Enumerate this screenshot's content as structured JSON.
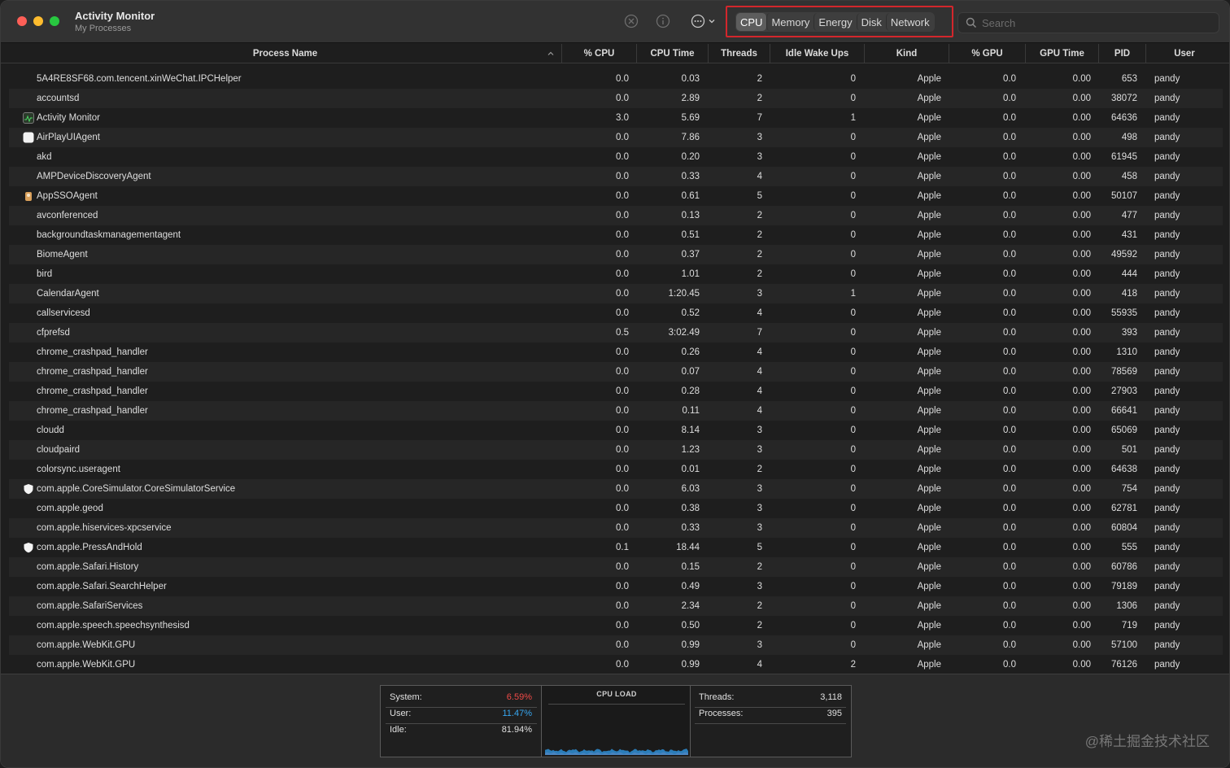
{
  "window": {
    "title": "Activity Monitor",
    "subtitle": "My Processes"
  },
  "toolbar": {
    "tabs": [
      {
        "label": "CPU",
        "active": true
      },
      {
        "label": "Memory",
        "active": false
      },
      {
        "label": "Energy",
        "active": false
      },
      {
        "label": "Disk",
        "active": false
      },
      {
        "label": "Network",
        "active": false
      }
    ],
    "search_placeholder": "Search",
    "icons": [
      "stop-process-icon",
      "info-icon",
      "more-actions-icon",
      "chevron-down-icon",
      "search-icon"
    ],
    "highlight_color": "#d3262c"
  },
  "table": {
    "columns": [
      "Process Name",
      "% CPU",
      "CPU Time",
      "Threads",
      "Idle Wake Ups",
      "Kind",
      "% GPU",
      "GPU Time",
      "PID",
      "User"
    ],
    "sorted_column": "Process Name",
    "sort_direction": "ascending",
    "rows": [
      {
        "name": "5A4RE8SF68.com.tencent.xinWeChat.IPCHelper",
        "cpu": "0.0",
        "cpu_time": "0.03",
        "threads": "2",
        "idle": "0",
        "kind": "Apple",
        "gpu": "0.0",
        "gpu_time": "0.00",
        "pid": "653",
        "user": "pandy",
        "icon": ""
      },
      {
        "name": "accountsd",
        "cpu": "0.0",
        "cpu_time": "2.89",
        "threads": "2",
        "idle": "0",
        "kind": "Apple",
        "gpu": "0.0",
        "gpu_time": "0.00",
        "pid": "38072",
        "user": "pandy",
        "icon": ""
      },
      {
        "name": "Activity Monitor",
        "cpu": "3.0",
        "cpu_time": "5.69",
        "threads": "7",
        "idle": "1",
        "kind": "Apple",
        "gpu": "0.0",
        "gpu_time": "0.00",
        "pid": "64636",
        "user": "pandy",
        "icon": "activity-monitor-icon"
      },
      {
        "name": "AirPlayUIAgent",
        "cpu": "0.0",
        "cpu_time": "7.86",
        "threads": "3",
        "idle": "0",
        "kind": "Apple",
        "gpu": "0.0",
        "gpu_time": "0.00",
        "pid": "498",
        "user": "pandy",
        "icon": "airplay-icon"
      },
      {
        "name": "akd",
        "cpu": "0.0",
        "cpu_time": "0.20",
        "threads": "3",
        "idle": "0",
        "kind": "Apple",
        "gpu": "0.0",
        "gpu_time": "0.00",
        "pid": "61945",
        "user": "pandy",
        "icon": ""
      },
      {
        "name": "AMPDeviceDiscoveryAgent",
        "cpu": "0.0",
        "cpu_time": "0.33",
        "threads": "4",
        "idle": "0",
        "kind": "Apple",
        "gpu": "0.0",
        "gpu_time": "0.00",
        "pid": "458",
        "user": "pandy",
        "icon": ""
      },
      {
        "name": "AppSSOAgent",
        "cpu": "0.0",
        "cpu_time": "0.61",
        "threads": "5",
        "idle": "0",
        "kind": "Apple",
        "gpu": "0.0",
        "gpu_time": "0.00",
        "pid": "50107",
        "user": "pandy",
        "icon": "app-sso-icon"
      },
      {
        "name": "avconferenced",
        "cpu": "0.0",
        "cpu_time": "0.13",
        "threads": "2",
        "idle": "0",
        "kind": "Apple",
        "gpu": "0.0",
        "gpu_time": "0.00",
        "pid": "477",
        "user": "pandy",
        "icon": ""
      },
      {
        "name": "backgroundtaskmanagementagent",
        "cpu": "0.0",
        "cpu_time": "0.51",
        "threads": "2",
        "idle": "0",
        "kind": "Apple",
        "gpu": "0.0",
        "gpu_time": "0.00",
        "pid": "431",
        "user": "pandy",
        "icon": ""
      },
      {
        "name": "BiomeAgent",
        "cpu": "0.0",
        "cpu_time": "0.37",
        "threads": "2",
        "idle": "0",
        "kind": "Apple",
        "gpu": "0.0",
        "gpu_time": "0.00",
        "pid": "49592",
        "user": "pandy",
        "icon": ""
      },
      {
        "name": "bird",
        "cpu": "0.0",
        "cpu_time": "1.01",
        "threads": "2",
        "idle": "0",
        "kind": "Apple",
        "gpu": "0.0",
        "gpu_time": "0.00",
        "pid": "444",
        "user": "pandy",
        "icon": ""
      },
      {
        "name": "CalendarAgent",
        "cpu": "0.0",
        "cpu_time": "1:20.45",
        "threads": "3",
        "idle": "1",
        "kind": "Apple",
        "gpu": "0.0",
        "gpu_time": "0.00",
        "pid": "418",
        "user": "pandy",
        "icon": ""
      },
      {
        "name": "callservicesd",
        "cpu": "0.0",
        "cpu_time": "0.52",
        "threads": "4",
        "idle": "0",
        "kind": "Apple",
        "gpu": "0.0",
        "gpu_time": "0.00",
        "pid": "55935",
        "user": "pandy",
        "icon": ""
      },
      {
        "name": "cfprefsd",
        "cpu": "0.5",
        "cpu_time": "3:02.49",
        "threads": "7",
        "idle": "0",
        "kind": "Apple",
        "gpu": "0.0",
        "gpu_time": "0.00",
        "pid": "393",
        "user": "pandy",
        "icon": ""
      },
      {
        "name": "chrome_crashpad_handler",
        "cpu": "0.0",
        "cpu_time": "0.26",
        "threads": "4",
        "idle": "0",
        "kind": "Apple",
        "gpu": "0.0",
        "gpu_time": "0.00",
        "pid": "1310",
        "user": "pandy",
        "icon": ""
      },
      {
        "name": "chrome_crashpad_handler",
        "cpu": "0.0",
        "cpu_time": "0.07",
        "threads": "4",
        "idle": "0",
        "kind": "Apple",
        "gpu": "0.0",
        "gpu_time": "0.00",
        "pid": "78569",
        "user": "pandy",
        "icon": ""
      },
      {
        "name": "chrome_crashpad_handler",
        "cpu": "0.0",
        "cpu_time": "0.28",
        "threads": "4",
        "idle": "0",
        "kind": "Apple",
        "gpu": "0.0",
        "gpu_time": "0.00",
        "pid": "27903",
        "user": "pandy",
        "icon": ""
      },
      {
        "name": "chrome_crashpad_handler",
        "cpu": "0.0",
        "cpu_time": "0.11",
        "threads": "4",
        "idle": "0",
        "kind": "Apple",
        "gpu": "0.0",
        "gpu_time": "0.00",
        "pid": "66641",
        "user": "pandy",
        "icon": ""
      },
      {
        "name": "cloudd",
        "cpu": "0.0",
        "cpu_time": "8.14",
        "threads": "3",
        "idle": "0",
        "kind": "Apple",
        "gpu": "0.0",
        "gpu_time": "0.00",
        "pid": "65069",
        "user": "pandy",
        "icon": ""
      },
      {
        "name": "cloudpaird",
        "cpu": "0.0",
        "cpu_time": "1.23",
        "threads": "3",
        "idle": "0",
        "kind": "Apple",
        "gpu": "0.0",
        "gpu_time": "0.00",
        "pid": "501",
        "user": "pandy",
        "icon": ""
      },
      {
        "name": "colorsync.useragent",
        "cpu": "0.0",
        "cpu_time": "0.01",
        "threads": "2",
        "idle": "0",
        "kind": "Apple",
        "gpu": "0.0",
        "gpu_time": "0.00",
        "pid": "64638",
        "user": "pandy",
        "icon": ""
      },
      {
        "name": "com.apple.CoreSimulator.CoreSimulatorService",
        "cpu": "0.0",
        "cpu_time": "6.03",
        "threads": "3",
        "idle": "0",
        "kind": "Apple",
        "gpu": "0.0",
        "gpu_time": "0.00",
        "pid": "754",
        "user": "pandy",
        "icon": "shield-icon"
      },
      {
        "name": "com.apple.geod",
        "cpu": "0.0",
        "cpu_time": "0.38",
        "threads": "3",
        "idle": "0",
        "kind": "Apple",
        "gpu": "0.0",
        "gpu_time": "0.00",
        "pid": "62781",
        "user": "pandy",
        "icon": ""
      },
      {
        "name": "com.apple.hiservices-xpcservice",
        "cpu": "0.0",
        "cpu_time": "0.33",
        "threads": "3",
        "idle": "0",
        "kind": "Apple",
        "gpu": "0.0",
        "gpu_time": "0.00",
        "pid": "60804",
        "user": "pandy",
        "icon": ""
      },
      {
        "name": "com.apple.PressAndHold",
        "cpu": "0.1",
        "cpu_time": "18.44",
        "threads": "5",
        "idle": "0",
        "kind": "Apple",
        "gpu": "0.0",
        "gpu_time": "0.00",
        "pid": "555",
        "user": "pandy",
        "icon": "shield-icon"
      },
      {
        "name": "com.apple.Safari.History",
        "cpu": "0.0",
        "cpu_time": "0.15",
        "threads": "2",
        "idle": "0",
        "kind": "Apple",
        "gpu": "0.0",
        "gpu_time": "0.00",
        "pid": "60786",
        "user": "pandy",
        "icon": ""
      },
      {
        "name": "com.apple.Safari.SearchHelper",
        "cpu": "0.0",
        "cpu_time": "0.49",
        "threads": "3",
        "idle": "0",
        "kind": "Apple",
        "gpu": "0.0",
        "gpu_time": "0.00",
        "pid": "79189",
        "user": "pandy",
        "icon": ""
      },
      {
        "name": "com.apple.SafariServices",
        "cpu": "0.0",
        "cpu_time": "2.34",
        "threads": "2",
        "idle": "0",
        "kind": "Apple",
        "gpu": "0.0",
        "gpu_time": "0.00",
        "pid": "1306",
        "user": "pandy",
        "icon": ""
      },
      {
        "name": "com.apple.speech.speechsynthesisd",
        "cpu": "0.0",
        "cpu_time": "0.50",
        "threads": "2",
        "idle": "0",
        "kind": "Apple",
        "gpu": "0.0",
        "gpu_time": "0.00",
        "pid": "719",
        "user": "pandy",
        "icon": ""
      },
      {
        "name": "com.apple.WebKit.GPU",
        "cpu": "0.0",
        "cpu_time": "0.99",
        "threads": "3",
        "idle": "0",
        "kind": "Apple",
        "gpu": "0.0",
        "gpu_time": "0.00",
        "pid": "57100",
        "user": "pandy",
        "icon": ""
      },
      {
        "name": "com.apple.WebKit.GPU",
        "cpu": "0.0",
        "cpu_time": "0.99",
        "threads": "4",
        "idle": "2",
        "kind": "Apple",
        "gpu": "0.0",
        "gpu_time": "0.00",
        "pid": "76126",
        "user": "pandy",
        "icon": ""
      }
    ]
  },
  "summary": {
    "system_label": "System:",
    "system_value": "6.59%",
    "user_label": "User:",
    "user_value": "11.47%",
    "idle_label": "Idle:",
    "idle_value": "81.94%",
    "graph_title": "CPU LOAD",
    "threads_label": "Threads:",
    "threads_value": "3,118",
    "processes_label": "Processes:",
    "processes_value": "395",
    "system_color": "#ef4a47",
    "user_color": "#37a7f1"
  },
  "watermark": "@稀土掘金技术社区"
}
